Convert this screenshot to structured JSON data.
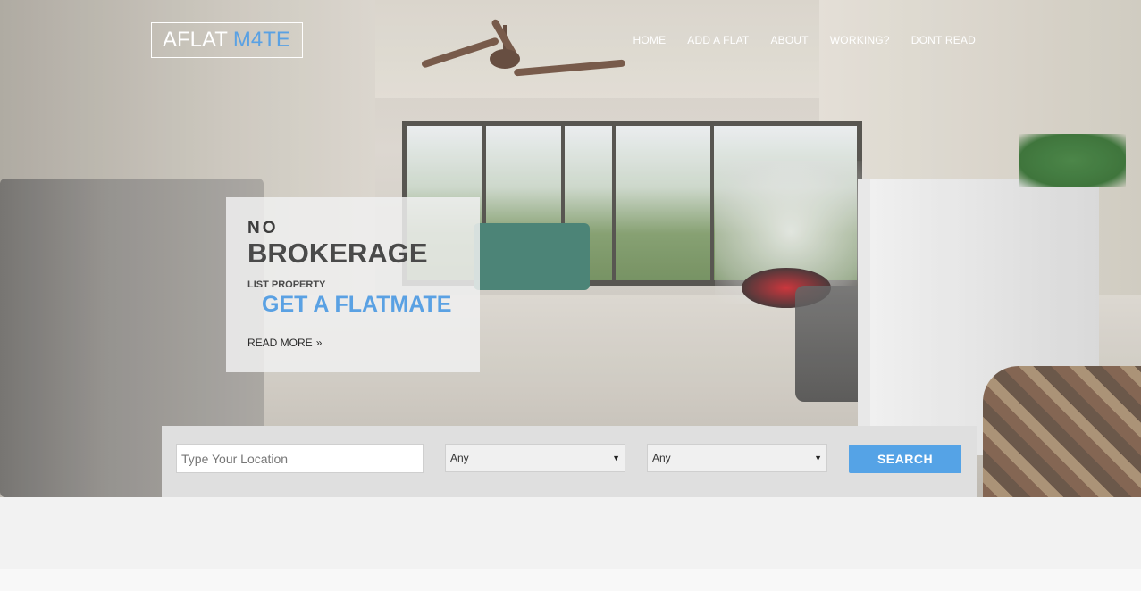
{
  "header": {
    "logo_main": "AFLAT",
    "logo_accent": "M4TE",
    "nav": [
      "HOME",
      "ADD A FLAT",
      "ABOUT",
      "WORKING?",
      "DONT READ"
    ]
  },
  "promo": {
    "kicker": "NO",
    "headline": "BROKERAGE",
    "small": "LIST PROPERTY",
    "cta": "GET A FLATMATE",
    "read_more": "READ MORE",
    "read_more_icon": "double-chevron-right-icon"
  },
  "search": {
    "location_placeholder": "Type Your Location",
    "select_1_value": "Any",
    "select_2_value": "Any",
    "button_label": "SEARCH"
  },
  "colors": {
    "accent": "#5aa1e3",
    "button": "#55a3e6",
    "panel": "#dfdfdf"
  }
}
